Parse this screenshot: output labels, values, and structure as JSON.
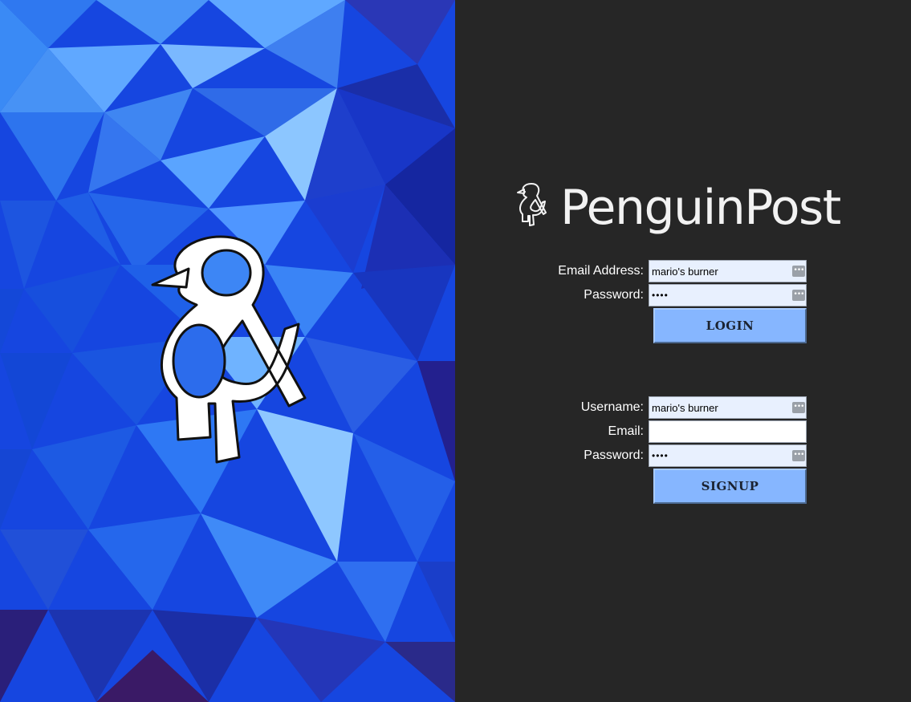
{
  "brand": {
    "name": "PenguinPost",
    "logo_icon": "penguin-ampersand-icon"
  },
  "login": {
    "email_label": "Email Address:",
    "email_value": "mario's burner",
    "password_label": "Password:",
    "password_value": "••••",
    "button_label": "LOGIN"
  },
  "signup": {
    "username_label": "Username:",
    "username_value": "mario's burner",
    "email_label": "Email:",
    "email_value": "",
    "password_label": "Password:",
    "password_value": "••••",
    "button_label": "SIGNUP"
  },
  "icons": {
    "autofill": "password-manager-key-icon"
  },
  "colors": {
    "panel_bg": "#262626",
    "button_bg": "#86b6ff",
    "autofill_bg": "#e8f0fe",
    "hero_blue": "#1646e0"
  }
}
